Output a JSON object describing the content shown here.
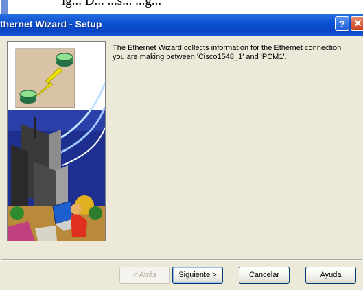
{
  "window": {
    "title": "thernet Wizard - Setup",
    "help_glyph": "?",
    "close_glyph": "✕"
  },
  "top_strip": {
    "partial_text": "ig... D... ...s... ...g..."
  },
  "message": "The Ethernet Wizard collects information for the Ethernet connection you are making between 'Cisco1548_1' and 'PCM1'.",
  "buttons": {
    "back": "< Atrás",
    "next": "Siguiente >",
    "cancel": "Cancelar",
    "help": "Ayuda"
  },
  "colors": {
    "titlebar": "#0a4fd0",
    "dialog_bg": "#ece9d8",
    "router_green": "#2e8b57",
    "lightning": "#f2e600"
  },
  "icons": {
    "help": "help-icon",
    "close": "close-icon",
    "illustration": "network-city-illustration"
  }
}
